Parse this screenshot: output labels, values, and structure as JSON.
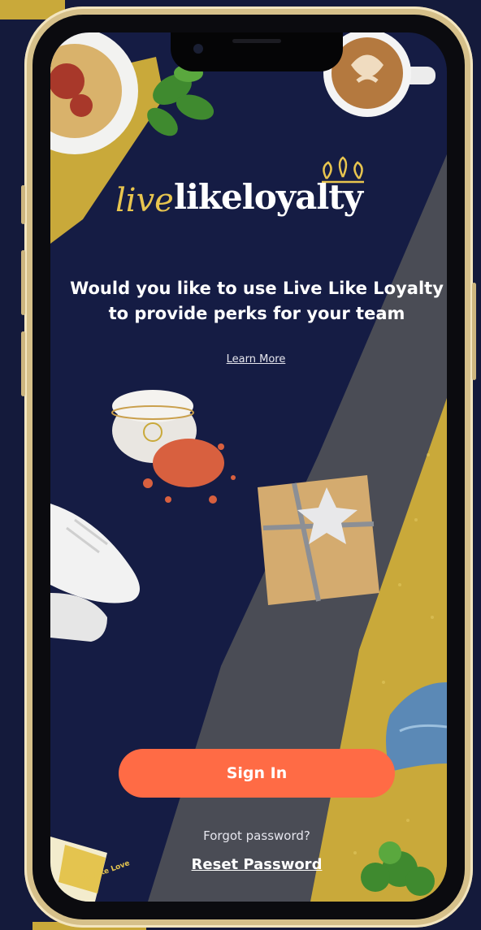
{
  "app": {
    "logo": {
      "script_text": "live",
      "serif_text": "likeloyalty"
    },
    "headline": "Would you like to use Live Like Loyalty to provide perks for your team",
    "learn_more_label": "Learn More",
    "sign_in_label": "Sign In",
    "forgot_text": "Forgot password?",
    "reset_label": "Reset Password",
    "card_text": "Live Like Love"
  },
  "colors": {
    "navy": "#151c44",
    "slate": "#4a4c55",
    "gold": "#c9a93a",
    "cta_orange": "#ff6b45",
    "white": "#ffffff"
  },
  "icons": {
    "crown": "crown-icon",
    "coffee": "coffee-cup-icon",
    "pasta": "pasta-plate-icon",
    "basil": "basil-leaves-icon",
    "jar": "cosmetic-jar-icon",
    "gift": "gift-box-icon",
    "sneaker": "sneaker-icon",
    "jeans": "denim-jeans-icon",
    "moss": "moss-icon"
  }
}
